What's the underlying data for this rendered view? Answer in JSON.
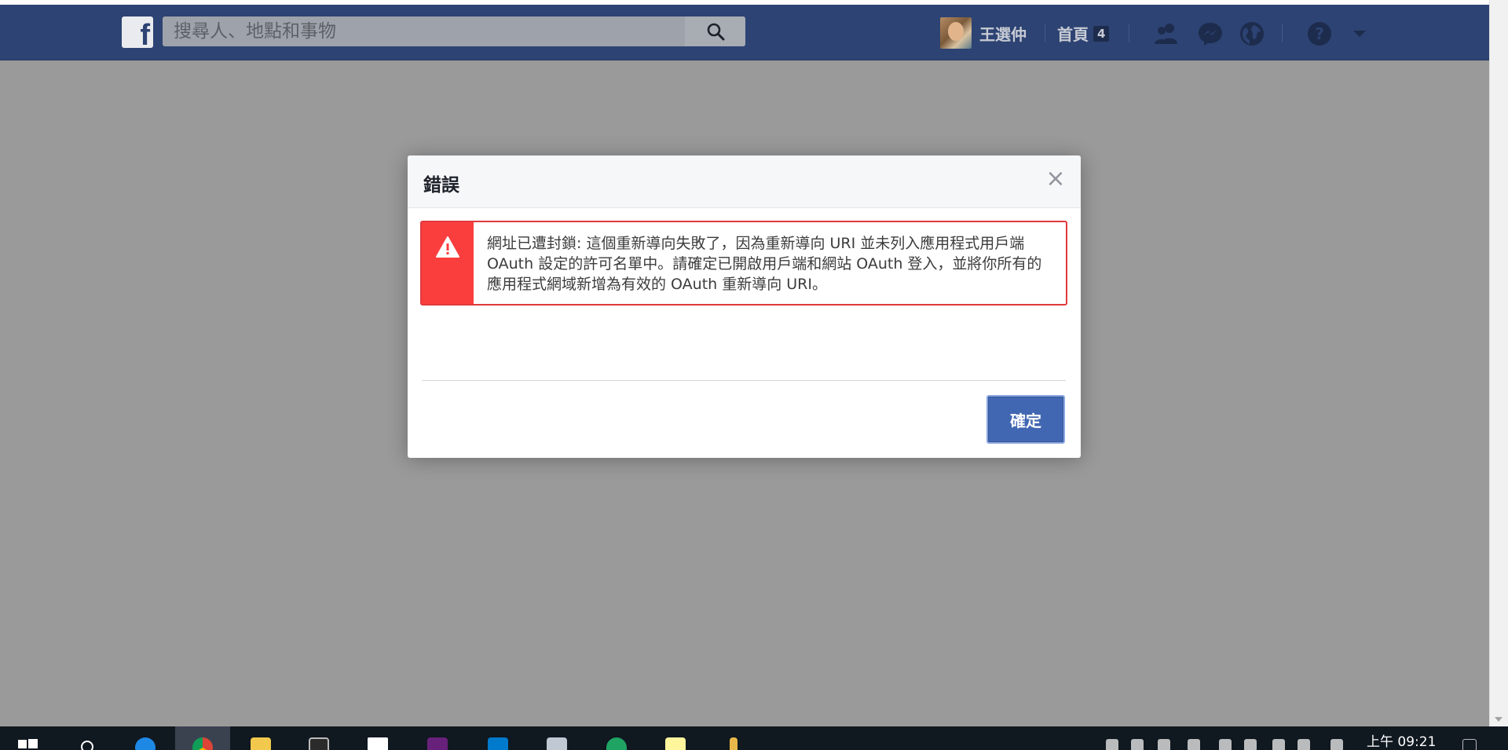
{
  "fb_header": {
    "logo_letter": "f",
    "search_placeholder": "搜尋人、地點和事物",
    "user_name": "王選仲",
    "home_label": "首頁",
    "home_count": "4"
  },
  "dialog": {
    "title": "錯誤",
    "close_label": "×",
    "error_message": "網址已遭封鎖: 這個重新導向失敗了，因為重新導向 URI 並未列入應用程式用戶端 OAuth 設定的許可名單中。請確定已開啟用戶端和網站 OAuth 登入，並將你所有的應用程式網域新增為有效的 OAuth 重新導向 URI。",
    "confirm_label": "確定"
  },
  "taskbar": {
    "clock_time": "上午 09:21",
    "apps": [
      "start-icon",
      "search-icon",
      "edge-icon",
      "chrome-icon",
      "file-explorer-icon",
      "terminal-icon",
      "mail-icon",
      "visual-studio-icon",
      "vscode-icon",
      "photos-icon",
      "google-drive-icon",
      "sticky-notes-icon",
      "app-icon"
    ]
  },
  "colors": {
    "fb_blue": "#2d4373",
    "overlay_gray": "#9a9a9a",
    "error_red": "#fa3e3e",
    "button_blue": "#4267b2"
  }
}
